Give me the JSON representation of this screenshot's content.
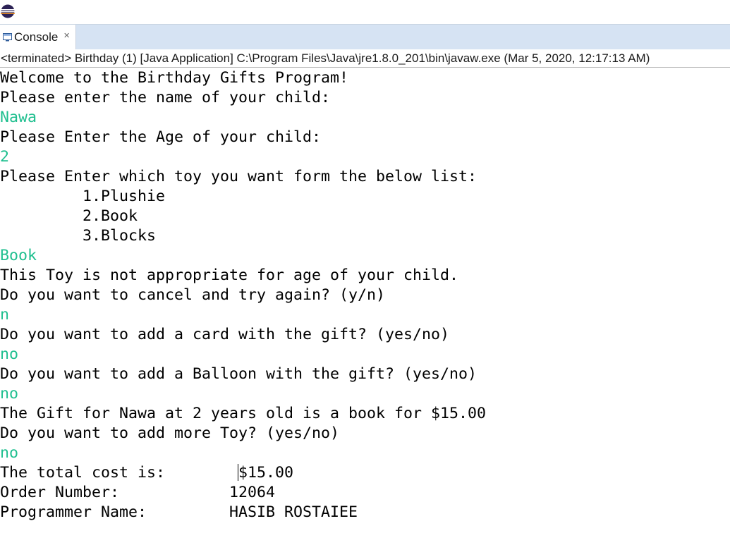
{
  "console": {
    "tab_label": "Console",
    "close_glyph": "✕",
    "status": "<terminated> Birthday (1) [Java Application] C:\\Program Files\\Java\\jre1.8.0_201\\bin\\javaw.exe (Mar 5, 2020, 12:17:13 AM)",
    "input_color": "#1fbf8f",
    "lines": [
      {
        "text": "Welcome to the Birthday Gifts Program!",
        "kind": "output"
      },
      {
        "text": "Please enter the name of your child:",
        "kind": "output"
      },
      {
        "text": "Nawa",
        "kind": "input"
      },
      {
        "text": "Please Enter the Age of your child:",
        "kind": "output"
      },
      {
        "text": "2",
        "kind": "input"
      },
      {
        "text": "Please Enter which toy you want form the below list:",
        "kind": "output"
      },
      {
        "text": "\t1.Plushie",
        "kind": "output"
      },
      {
        "text": "\t2.Book",
        "kind": "output"
      },
      {
        "text": "\t3.Blocks",
        "kind": "output"
      },
      {
        "text": "Book",
        "kind": "input"
      },
      {
        "text": "This Toy is not appropriate for age of your child.",
        "kind": "output"
      },
      {
        "text": "Do you want to cancel and try again? (y/n)",
        "kind": "output"
      },
      {
        "text": "n",
        "kind": "input"
      },
      {
        "text": "Do you want to add a card with the gift? (yes/no)",
        "kind": "output"
      },
      {
        "text": "no",
        "kind": "input"
      },
      {
        "text": "Do you want to add a Balloon with the gift? (yes/no)",
        "kind": "output"
      },
      {
        "text": "no",
        "kind": "input"
      },
      {
        "text": "The Gift for Nawa at 2 years old is a book for $15.00",
        "kind": "output"
      },
      {
        "text": "Do you want to add more Toy? (yes/no)",
        "kind": "output"
      },
      {
        "text": "no",
        "kind": "input"
      },
      {
        "text": "The total cost is:        $15.00",
        "kind": "output"
      },
      {
        "text": "Order Number:            12064",
        "kind": "output"
      },
      {
        "text": "Programmer Name:         HASIB ROSTAIEE",
        "kind": "output"
      }
    ]
  }
}
